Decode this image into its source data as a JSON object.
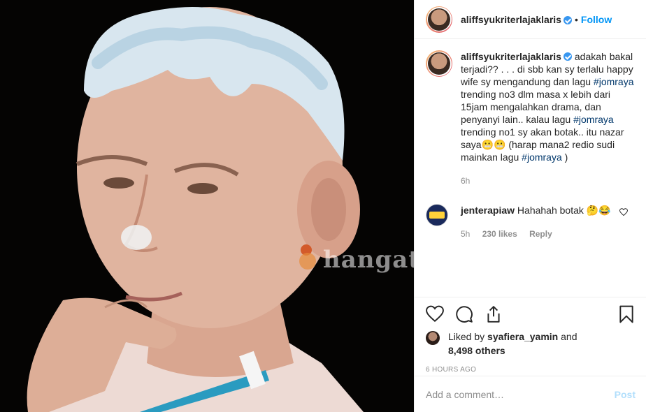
{
  "photo": {
    "watermark": "hangat.c"
  },
  "post": {
    "username": "aliffsyukriterlajaklaris",
    "follow_label": "Follow",
    "separator": "•",
    "caption": {
      "username": "aliffsyukriterlajaklaris",
      "parts": [
        {
          "text": " adakah bakal terjadi?? .\n. .\ndi sbb kan sy terlalu happy wife sy mengandung dan lagu ",
          "type": "text"
        },
        {
          "text": "#jomraya",
          "type": "hashtag"
        },
        {
          "text": " trending no3 dlm masa x lebih dari 15jam mengalahkan drama, dan penyanyi lain.. kalau lagu ",
          "type": "text"
        },
        {
          "text": "#jomraya",
          "type": "hashtag"
        },
        {
          "text": " trending no1 sy akan botak.. itu nazar saya😬😬 (harap mana2 redio sudi mainkan lagu ",
          "type": "text"
        },
        {
          "text": "#jomraya",
          "type": "hashtag"
        },
        {
          "text": " )",
          "type": "text"
        }
      ],
      "time": "6h"
    },
    "comment": {
      "username": "jenterapiaw",
      "text": "Hahahah botak 🤔😂",
      "time": "5h",
      "likes": "230 likes",
      "reply_label": "Reply"
    },
    "likes": {
      "prefix": "Liked by ",
      "user": "syafiera_yamin",
      "middle": " and",
      "others": "8,498 others"
    },
    "timestamp": "6 HOURS AGO",
    "add_comment_placeholder": "Add a comment…",
    "post_label": "Post"
  },
  "colors": {
    "link_blue": "#0095f6",
    "hashtag": "#00376b",
    "muted": "#8e8e8e",
    "post_disabled": "#b2dffc"
  },
  "icons": [
    "heart-icon",
    "comment-icon",
    "share-icon",
    "bookmark-icon",
    "verified-badge-icon"
  ]
}
